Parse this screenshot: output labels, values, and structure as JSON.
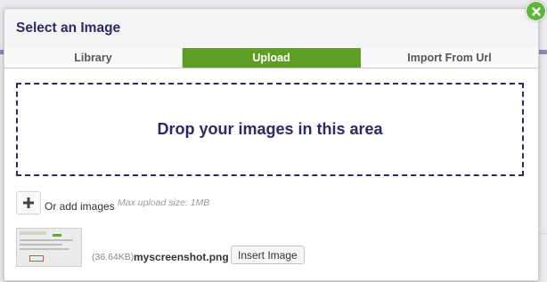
{
  "modal": {
    "title": "Select an Image",
    "close_icon": "close-icon"
  },
  "tabs": [
    {
      "label": "Library",
      "active": false
    },
    {
      "label": "Upload",
      "active": true
    },
    {
      "label": "Import From Url",
      "active": false
    }
  ],
  "dropzone": {
    "text": "Drop your images in this area"
  },
  "add": {
    "icon": "plus-icon",
    "label": "Or add images",
    "max_size": "Max upload size: 1MB"
  },
  "file": {
    "size": "(36.64KB)",
    "name": "myscreenshot.png",
    "insert_label": "Insert Image"
  },
  "colors": {
    "accent_green": "#5e9e24",
    "title_navy": "#2b2a66"
  }
}
